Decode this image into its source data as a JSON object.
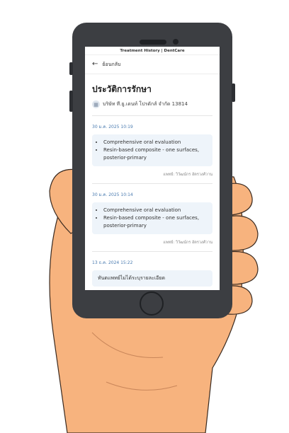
{
  "app": {
    "header_title": "Treatment History | DentCare"
  },
  "nav": {
    "back_label": "ย้อนกลับ"
  },
  "page": {
    "title": "ประวัติการรักษา",
    "clinic_name": "บริษัท ที.ยู.เดนท์ โปรดักส์ จำกัด 13814"
  },
  "records": [
    {
      "date": "30 ม.ค. 2025 10:19",
      "items": [
        "Comprehensive oral evaluation",
        "Resin-based composite - one surfaces, posterior-primary"
      ],
      "doctor": "แพทย์: วิวัฒน์กร อัตรวงศ์วาน"
    },
    {
      "date": "30 ม.ค. 2025 10:14",
      "items": [
        "Comprehensive oral evaluation",
        "Resin-based composite - one surfaces, posterior-primary"
      ],
      "doctor": "แพทย์: วิวัฒน์กร อัตรวงศ์วาน"
    },
    {
      "date": "13 ธ.ค. 2024 15:22",
      "note": "ทันตแพทย์ไม่ได้ระบุรายละเอียด"
    }
  ],
  "colors": {
    "skin": "#f7b37e",
    "phone_body": "#3c3e42",
    "card_bg": "#eef4fa",
    "date_text": "#4a7bb0"
  }
}
